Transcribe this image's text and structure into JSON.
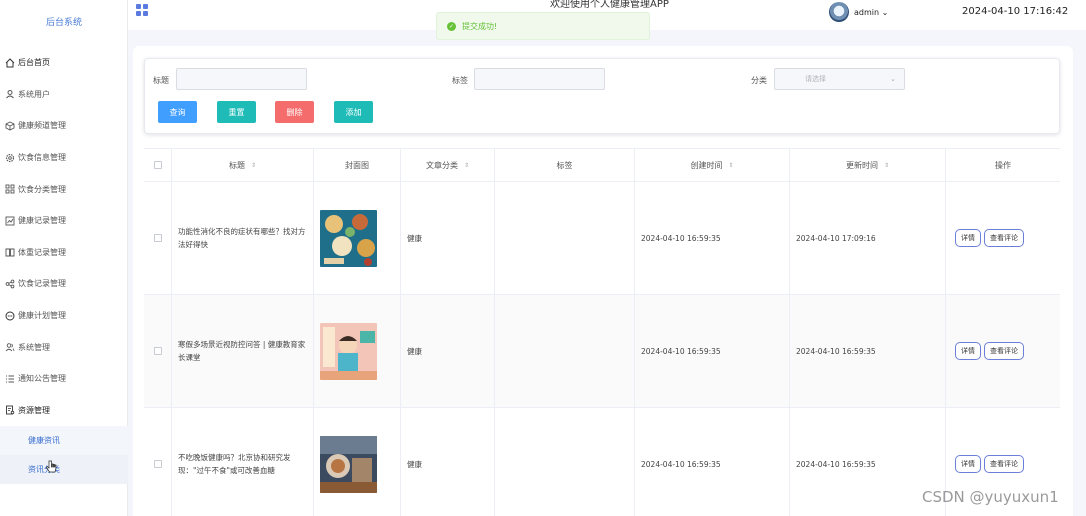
{
  "sidebar": {
    "brand": "后台系统",
    "items": [
      {
        "label": "后台首页",
        "icon": "home-icon"
      },
      {
        "label": "系统用户",
        "icon": "user-icon"
      },
      {
        "label": "健康频道管理",
        "icon": "cube-icon"
      },
      {
        "label": "饮食信息管理",
        "icon": "gear-icon"
      },
      {
        "label": "饮食分类管理",
        "icon": "grid-icon"
      },
      {
        "label": "健康记录管理",
        "icon": "chart-icon"
      },
      {
        "label": "体重记录管理",
        "icon": "book-icon"
      },
      {
        "label": "饮食记录管理",
        "icon": "share-icon"
      },
      {
        "label": "健康计划管理",
        "icon": "chat-icon"
      },
      {
        "label": "系统管理",
        "icon": "users-icon"
      },
      {
        "label": "通知公告管理",
        "icon": "list-icon"
      },
      {
        "label": "资源管理",
        "icon": "doc-icon"
      }
    ],
    "sub_items": [
      {
        "label": "健康资讯"
      },
      {
        "label": "资讯分类"
      }
    ]
  },
  "topbar": {
    "welcome": "欢迎使用个人健康管理APP",
    "username": "admin",
    "datetime": "2024-04-10 17:16:42"
  },
  "toast": {
    "message": "提交成功!"
  },
  "search": {
    "title_label": "标题",
    "tag_label": "标签",
    "category_label": "分类",
    "category_placeholder": "请选择",
    "buttons": {
      "query": "查询",
      "reset": "重置",
      "delete": "删除",
      "add": "添加"
    }
  },
  "table": {
    "headers": {
      "title": "标题",
      "cover": "封面图",
      "category": "文章分类",
      "tags": "标签",
      "created": "创建时间",
      "updated": "更新时间",
      "actions": "操作"
    },
    "rows": [
      {
        "title": "功能性消化不良的症状有哪些？找对方法好得快",
        "category": "健康",
        "tags": "",
        "created": "2024-04-10 16:59:35",
        "updated": "2024-04-10 17:09:16"
      },
      {
        "title": "寒假多场景近视防控问答 | 健康教育家长课堂",
        "category": "健康",
        "tags": "",
        "created": "2024-04-10 16:59:35",
        "updated": "2024-04-10 16:59:35"
      },
      {
        "title": "不吃晚饭健康吗？北京协和研究发现：\"过午不食\"或可改善血糖",
        "category": "健康",
        "tags": "",
        "created": "2024-04-10 16:59:35",
        "updated": "2024-04-10 16:59:35"
      }
    ],
    "row_actions": {
      "detail": "详情",
      "comments": "查看评论"
    }
  },
  "watermark": "CSDN @yuyuxun1",
  "colors": {
    "query": "#409eff",
    "reset": "#1fbcb7",
    "delete": "#f56c6c",
    "add": "#1fbcb7",
    "brand": "#4a7bd6",
    "success": "#67c23a"
  }
}
